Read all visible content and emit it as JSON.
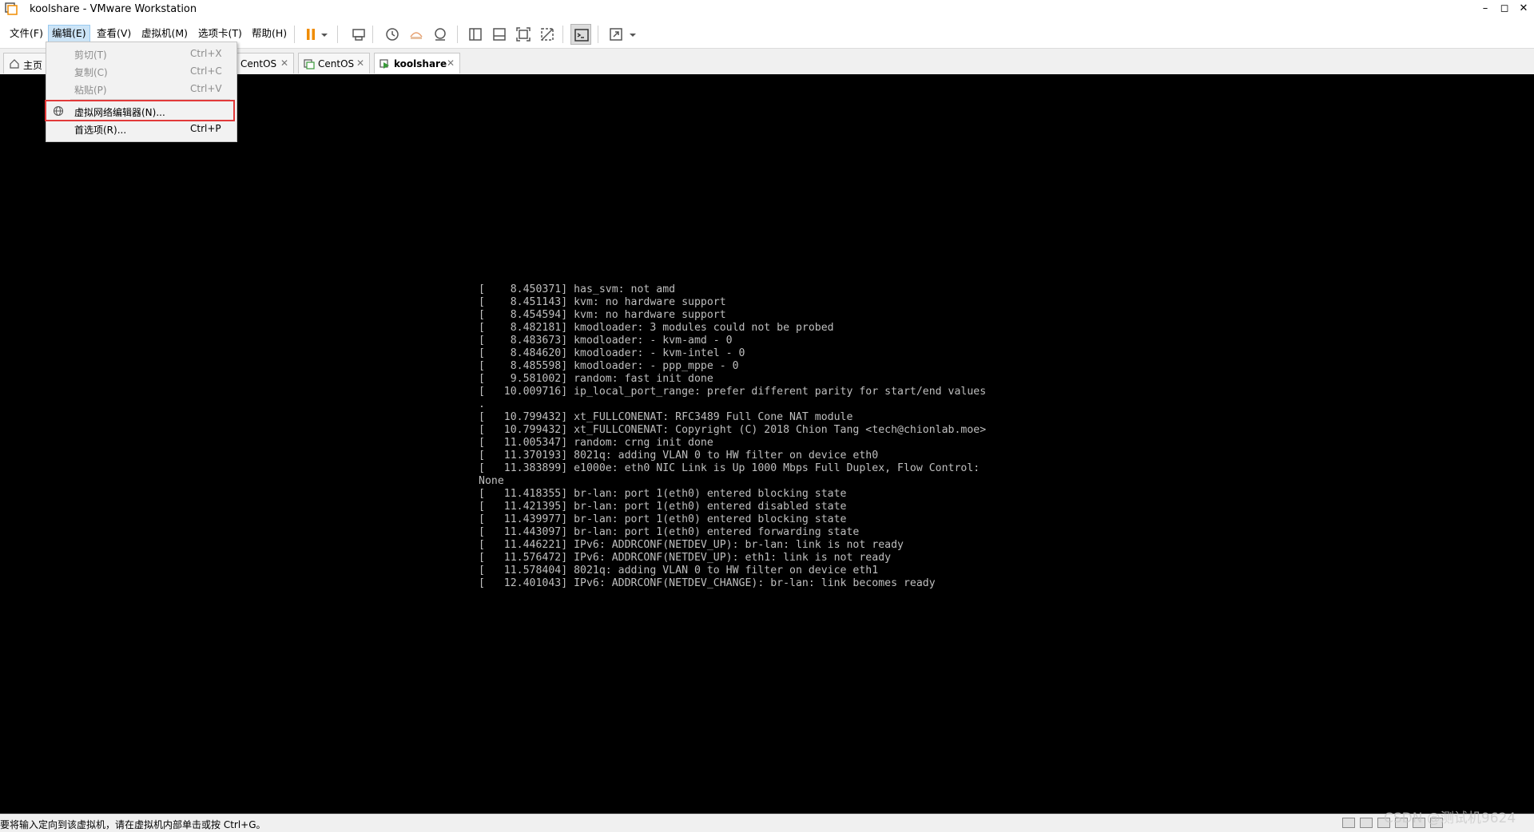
{
  "window": {
    "title": "koolshare - VMware Workstation",
    "controls": {
      "minimize": "–",
      "maximize": "◻",
      "close": "✕"
    }
  },
  "menubar": {
    "items": [
      "文件(F)",
      "编辑(E)",
      "查看(V)",
      "虚拟机(M)",
      "选项卡(T)",
      "帮助(H)"
    ],
    "active_index": 1
  },
  "toolbar": {
    "icons": [
      "pause-icon",
      "dropdown-arrow-icon",
      "send-ctrl-alt-del-icon",
      "snapshot-icon",
      "revert-snapshot-icon",
      "snapshot-manager-icon",
      "library-view-icon",
      "thumbnail-bar-icon",
      "fullscreen-icon",
      "unity-icon",
      "console-view-icon",
      "stretch-guest-icon"
    ]
  },
  "tabs": [
    {
      "label": "主页",
      "icon": "home-icon",
      "closable": false
    },
    {
      "label": "CentOS",
      "icon": "vm-icon",
      "closable": true
    },
    {
      "label": "CentOS",
      "icon": "vm-icon",
      "closable": true
    },
    {
      "label": "koolshare",
      "icon": "vm-running-icon",
      "closable": true,
      "active": true
    }
  ],
  "tab_close_glyph": "✕",
  "edit_menu": {
    "items": [
      {
        "label": "剪切(T)",
        "shortcut": "Ctrl+X",
        "disabled": true
      },
      {
        "label": "复制(C)",
        "shortcut": "Ctrl+C",
        "disabled": true
      },
      {
        "label": "粘贴(P)",
        "shortcut": "Ctrl+V",
        "disabled": true
      },
      {
        "label": "虚拟网络编辑器(N)...",
        "shortcut": "",
        "icon": "network-globe-icon",
        "highlighted": true
      },
      {
        "label": "首选项(R)...",
        "shortcut": "Ctrl+P"
      }
    ]
  },
  "console": {
    "lines": [
      "[    8.450371] has_svm: not amd",
      "[    8.451143] kvm: no hardware support",
      "[    8.454594] kvm: no hardware support",
      "[    8.482181] kmodloader: 3 modules could not be probed",
      "[    8.483673] kmodloader: - kvm-amd - 0",
      "[    8.484620] kmodloader: - kvm-intel - 0",
      "[    8.485598] kmodloader: - ppp_mppe - 0",
      "[    9.581002] random: fast init done",
      "[   10.009716] ip_local_port_range: prefer different parity for start/end values",
      ".",
      "[   10.799432] xt_FULLCONENAT: RFC3489 Full Cone NAT module",
      "[   10.799432] xt_FULLCONENAT: Copyright (C) 2018 Chion Tang <tech@chionlab.moe>",
      "[   11.005347] random: crng init done",
      "[   11.370193] 8021q: adding VLAN 0 to HW filter on device eth0",
      "[   11.383899] e1000e: eth0 NIC Link is Up 1000 Mbps Full Duplex, Flow Control:",
      "None",
      "[   11.418355] br-lan: port 1(eth0) entered blocking state",
      "[   11.421395] br-lan: port 1(eth0) entered disabled state",
      "[   11.439977] br-lan: port 1(eth0) entered blocking state",
      "[   11.443097] br-lan: port 1(eth0) entered forwarding state",
      "[   11.446221] IPv6: ADDRCONF(NETDEV_UP): br-lan: link is not ready",
      "[   11.576472] IPv6: ADDRCONF(NETDEV_UP): eth1: link is not ready",
      "[   11.578404] 8021q: adding VLAN 0 to HW filter on device eth1",
      "[   12.401043] IPv6: ADDRCONF(NETDEV_CHANGE): br-lan: link becomes ready"
    ]
  },
  "statusbar": {
    "text": "要将输入定向到该虚拟机，请在虚拟机内部单击或按 Ctrl+G。"
  },
  "watermark": "CSDN @测试机9624",
  "colors": {
    "highlight_border": "#e23a3a",
    "menu_active": "#cce4f7",
    "console_bg": "#000000",
    "console_fg": "#bfbfbf",
    "pause_orange": "#f08c00"
  }
}
